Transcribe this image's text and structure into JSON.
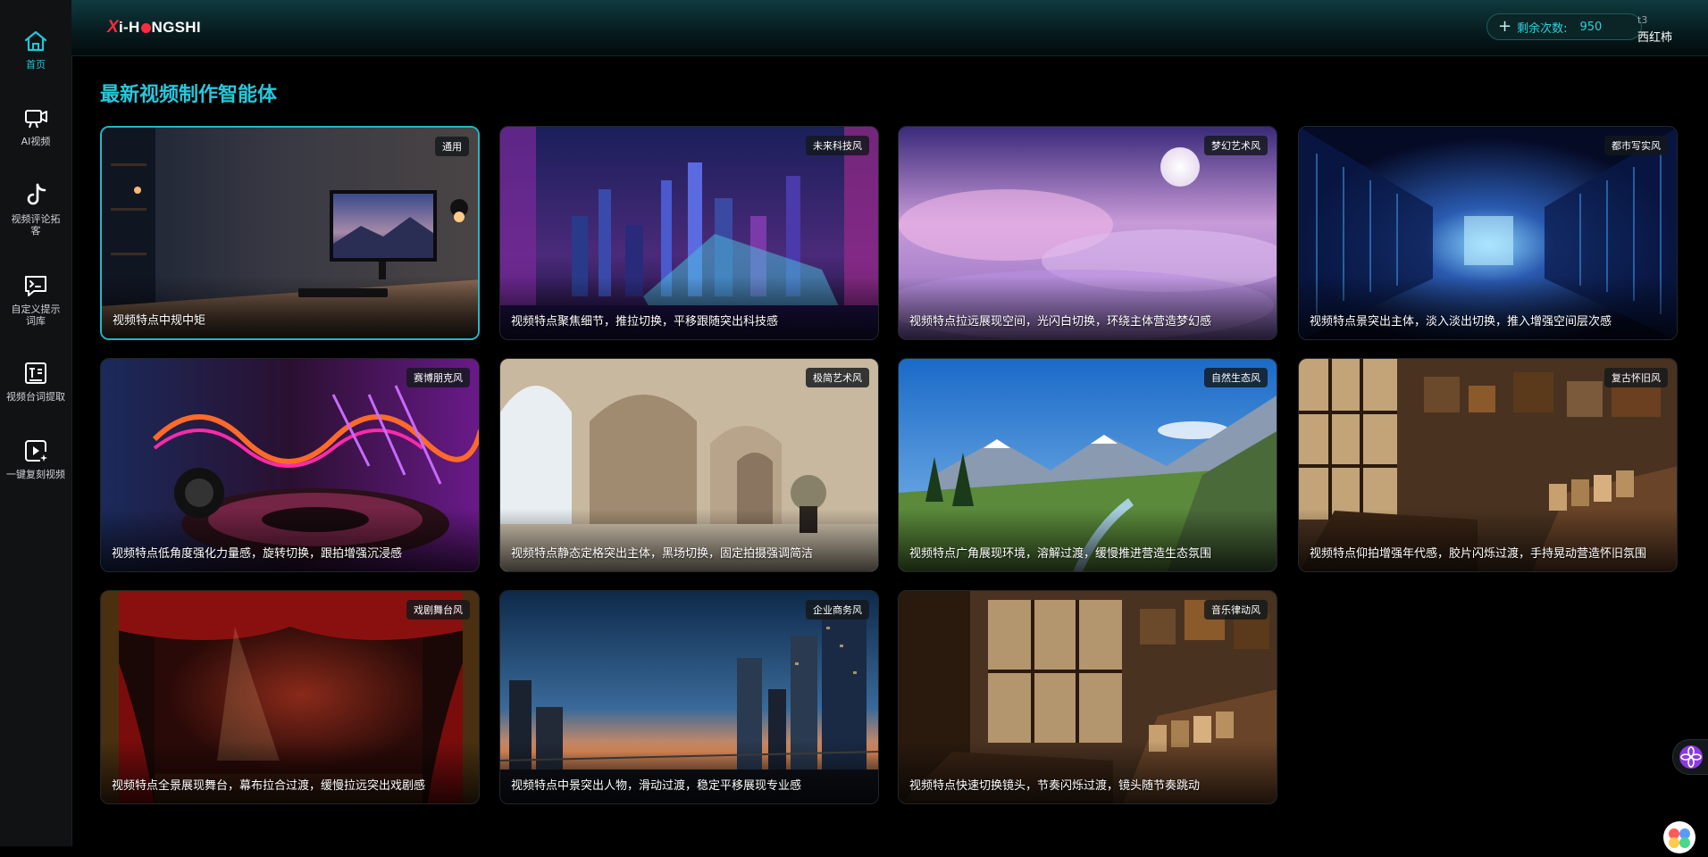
{
  "app": {
    "logo_text_1": "X",
    "logo_text_2": "i-H",
    "logo_text_3": "NGSHI",
    "credits_label": "剩余次数:",
    "credits_count": "950",
    "user_id": "t3",
    "user_name": "西红柿"
  },
  "sidebar": {
    "items": [
      {
        "label": "首页",
        "icon": "home-icon"
      },
      {
        "label": "AI视频",
        "icon": "video-camera-icon"
      },
      {
        "label": "视频评论拓客",
        "icon": "tiktok-icon"
      },
      {
        "label": "自定义提示词库",
        "icon": "prompt-icon"
      },
      {
        "label": "视频台词提取",
        "icon": "text-extract-icon"
      },
      {
        "label": "一键复刻视频",
        "icon": "video-clone-icon"
      }
    ]
  },
  "main": {
    "title": "最新视频制作智能体",
    "cards": [
      {
        "tag": "通用",
        "desc": "视频特点中规中矩"
      },
      {
        "tag": "未来科技风",
        "desc": "视频特点聚焦细节，推拉切换，平移跟随突出科技感"
      },
      {
        "tag": "梦幻艺术风",
        "desc": "视频特点拉远展现空间，光闪白切换，环绕主体营造梦幻感"
      },
      {
        "tag": "都市写实风",
        "desc": "视频特点景突出主体，淡入淡出切换，推入增强空间层次感"
      },
      {
        "tag": "赛博朋克风",
        "desc": "视频特点低角度强化力量感，旋转切换，跟拍增强沉浸感"
      },
      {
        "tag": "极简艺术风",
        "desc": "视频特点静态定格突出主体，黑场切换，固定拍摄强调简洁"
      },
      {
        "tag": "自然生态风",
        "desc": "视频特点广角展现环境，溶解过渡，缓慢推进营造生态氛围"
      },
      {
        "tag": "复古怀旧风",
        "desc": "视频特点仰拍增强年代感，胶片闪烁过渡，手持晃动营造怀旧氛围"
      },
      {
        "tag": "戏剧舞台风",
        "desc": "视频特点全景展现舞台，幕布拉合过渡，缓慢拉远突出戏剧感"
      },
      {
        "tag": "企业商务风",
        "desc": "视频特点中景突出人物，滑动过渡，稳定平移展现专业感"
      },
      {
        "tag": "音乐律动风",
        "desc": "视频特点快速切换镜头，节奏闪烁过渡，镜头随节奏跳动"
      }
    ]
  },
  "colors": {
    "accent": "#27c8dc",
    "logo_red": "#ff2a3d",
    "background": "#000000",
    "sidebar": "#111214"
  }
}
